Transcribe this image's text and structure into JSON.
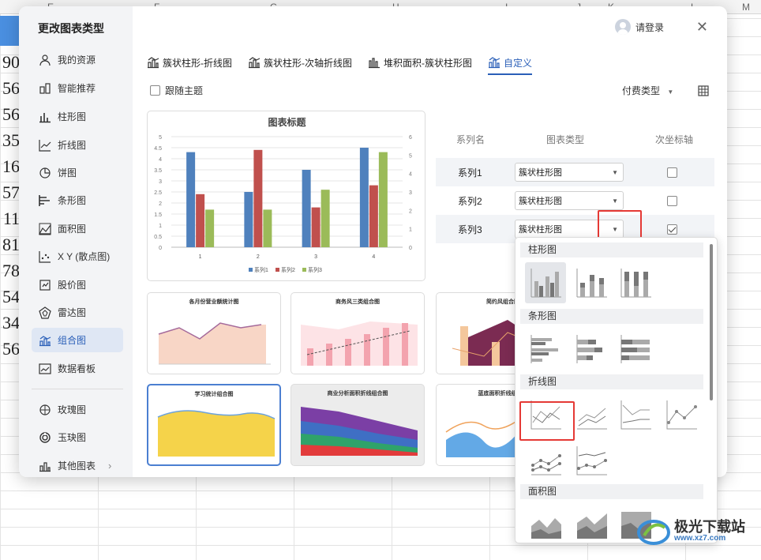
{
  "sheet": {
    "columns": [
      "E",
      "F",
      "G",
      "H",
      "I",
      "J",
      "K",
      "L",
      "M"
    ],
    "left_values": [
      "90",
      "56",
      "56",
      "35",
      "16",
      "57",
      "11",
      "81",
      "78",
      "54",
      "34",
      "56"
    ]
  },
  "dialog": {
    "title": "更改图表类型",
    "close_symbol": "✕",
    "login": "请登录",
    "sidebar": [
      {
        "label": "我的资源",
        "icon": "user-icon"
      },
      {
        "label": "智能推荐",
        "icon": "smart-recommend-icon"
      },
      {
        "label": "柱形图",
        "icon": "column-chart-icon"
      },
      {
        "label": "折线图",
        "icon": "line-chart-icon"
      },
      {
        "label": "饼图",
        "icon": "pie-chart-icon"
      },
      {
        "label": "条形图",
        "icon": "bar-chart-icon"
      },
      {
        "label": "面积图",
        "icon": "area-chart-icon"
      },
      {
        "label": "X Y (散点图)",
        "icon": "scatter-chart-icon"
      },
      {
        "label": "股价图",
        "icon": "stock-chart-icon"
      },
      {
        "label": "雷达图",
        "icon": "radar-chart-icon"
      },
      {
        "label": "组合图",
        "icon": "combo-chart-icon",
        "active": true
      },
      {
        "label": "数据看板",
        "icon": "dashboard-icon"
      },
      {
        "label": "玫瑰图",
        "icon": "rose-chart-icon"
      },
      {
        "label": "玉玦图",
        "icon": "jade-ring-chart-icon"
      },
      {
        "label": "其他图表",
        "icon": "other-chart-icon",
        "arrow": "›"
      }
    ],
    "tabs": [
      {
        "label": "簇状柱形-折线图"
      },
      {
        "label": "簇状柱形-次轴折线图"
      },
      {
        "label": "堆积面积-簇状柱形图"
      },
      {
        "label": "自定义",
        "active": true
      }
    ],
    "follow_theme": "跟随主题",
    "pay_type": "付费类型",
    "pay_type_arrow": "▼",
    "series_panel": {
      "headers": [
        "系列名",
        "图表类型",
        "次坐标轴"
      ],
      "rows": [
        {
          "name": "系列1",
          "type": "簇状柱形图",
          "secondary": false
        },
        {
          "name": "系列2",
          "type": "簇状柱形图",
          "secondary": false
        },
        {
          "name": "系列3",
          "type": "簇状柱形图",
          "secondary": true
        }
      ]
    },
    "thumbnails": [
      {
        "title": "各月份营业额统计图"
      },
      {
        "title": "商务风三类组合图"
      },
      {
        "title": "简约风组合图"
      },
      {
        "title": "学习统计组合图"
      },
      {
        "title": "商业分析面积折线组合图"
      },
      {
        "title": "蓝底面积折线组合图"
      }
    ],
    "popup": {
      "sections": [
        "柱形图",
        "条形图",
        "折线图",
        "面积图"
      ]
    }
  },
  "chart_data": {
    "type": "bar",
    "title": "图表标题",
    "categories": [
      "1",
      "2",
      "3",
      "4"
    ],
    "series": [
      {
        "name": "系列1",
        "values": [
          4.3,
          2.5,
          3.5,
          4.5
        ],
        "color": "#4f81bd"
      },
      {
        "name": "系列2",
        "values": [
          2.4,
          4.4,
          1.8,
          2.8
        ],
        "color": "#c0504d"
      },
      {
        "name": "系列3",
        "values": [
          1.7,
          1.7,
          2.6,
          4.3
        ],
        "color": "#9bbb59"
      }
    ],
    "ylim": [
      0,
      5
    ],
    "yticks": [
      "0",
      "0.5",
      "1",
      "1.5",
      "2",
      "2.5",
      "3",
      "3.5",
      "4",
      "4.5",
      "5"
    ],
    "y2lim": [
      0,
      6
    ],
    "y2ticks": [
      "0",
      "1",
      "2",
      "3",
      "4",
      "5",
      "6"
    ],
    "legend": "bottom",
    "grid": true
  },
  "watermark": {
    "text": "极光下载站",
    "url": "www.xz7.com"
  }
}
